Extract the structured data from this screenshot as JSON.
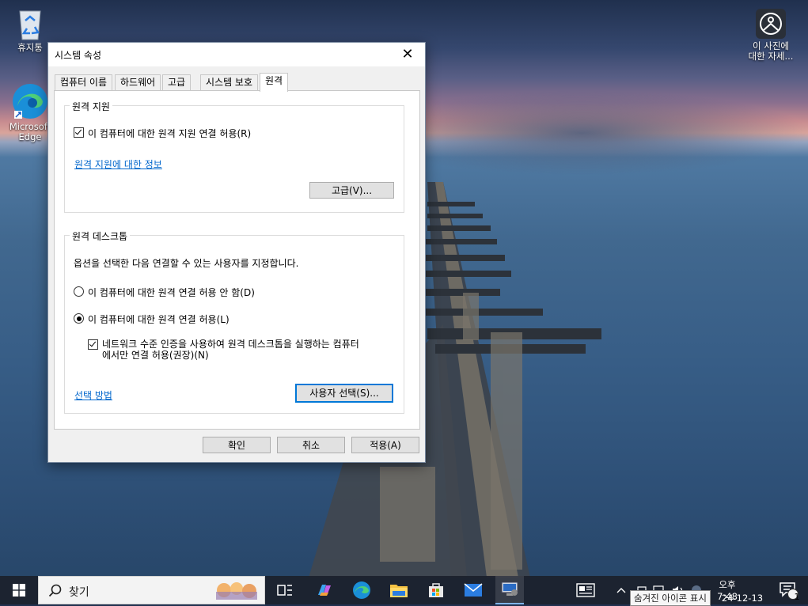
{
  "desktop": {
    "icons": [
      {
        "label": "휴지통"
      },
      {
        "label_lines": [
          "Microsoft",
          "Edge"
        ]
      },
      {
        "label_lines": [
          "이 사진에",
          "대한 자세..."
        ]
      }
    ]
  },
  "dialog": {
    "title": "시스템 속성",
    "close_symbol": "✕",
    "tabs": [
      "컴퓨터 이름",
      "하드웨어",
      "고급",
      "시스템 보호",
      "원격"
    ],
    "active_tab": "원격",
    "remote_assistance": {
      "group_title": "원격 지원",
      "allow_checkbox_label": "이 컴퓨터에 대한 원격 지원 연결 허용(R)",
      "allow_checked": true,
      "info_link": "원격 지원에 대한 정보",
      "advanced_button": "고급(V)..."
    },
    "remote_desktop": {
      "group_title": "원격 데스크톱",
      "description": "옵션을 선택한 다음 연결할 수 있는 사용자를 지정합니다.",
      "option_deny": "이 컴퓨터에 대한 원격 연결 허용 안 함(D)",
      "option_allow": "이 컴퓨터에 대한 원격 연결 허용(L)",
      "selected_option": "allow",
      "nla_label_line1": "네트워크 수준 인증을 사용하여 원격 데스크톱을 실행하는 컴퓨터",
      "nla_label_line2": "에서만 연결 허용(권장)(N)",
      "nla_checked": true,
      "help_link": "선택 방법",
      "select_users_button": "사용자 선택(S)..."
    },
    "buttons": {
      "ok": "확인",
      "cancel": "취소",
      "apply": "적용(A)"
    }
  },
  "taskbar": {
    "search_placeholder": "찾기",
    "clock_time": "오후 7:48",
    "clock_date": "24-12-13",
    "tooltip": "숨겨진 아이콘 표시",
    "notification_count": "1"
  },
  "colors": {
    "link": "#0066cc",
    "accent": "#0078d7"
  }
}
